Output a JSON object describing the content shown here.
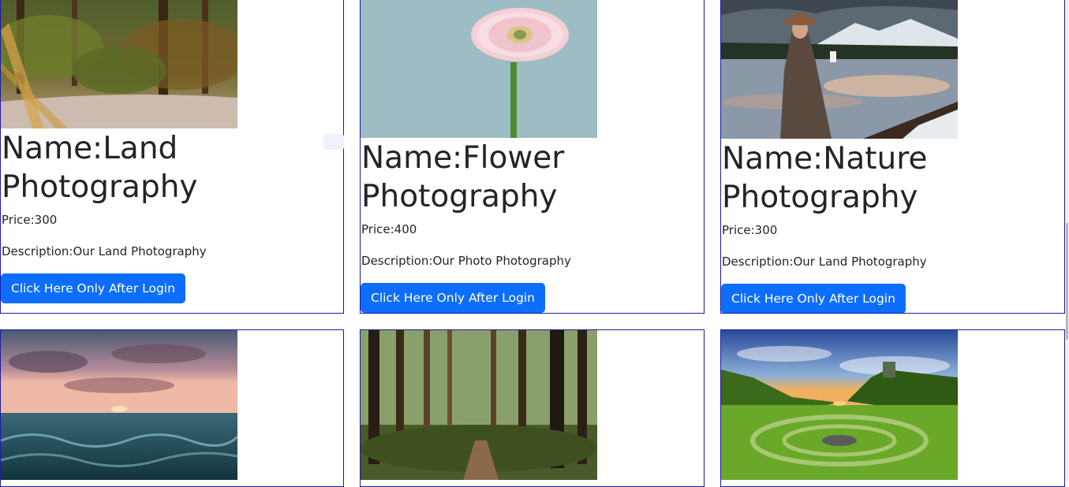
{
  "products": [
    {
      "name": "Name:Land Photography",
      "price": "Price:300",
      "description": "Description:Our Land Photography",
      "button": "Click Here Only After Login",
      "image_icon": "forest-stream-photo"
    },
    {
      "name": "Name:Flower Photography",
      "price": "Price:400",
      "description": "Description:Our Photo Photography",
      "button": "Click Here Only After Login",
      "image_icon": "pink-gerbera-flower-photo"
    },
    {
      "name": "Name:Nature Photography",
      "price": "Price:300",
      "description": "Description:Our Land Photography",
      "button": "Click Here Only After Login",
      "image_icon": "woman-by-mountain-lake-photo"
    }
  ],
  "gallery_row2": [
    {
      "image_icon": "ocean-sunset-photo"
    },
    {
      "image_icon": "forest-path-photo"
    },
    {
      "image_icon": "green-valley-sunset-photo"
    }
  ],
  "colors": {
    "accent": "#0d6efd",
    "card_border": "#1a1aa6",
    "text": "#212529"
  }
}
